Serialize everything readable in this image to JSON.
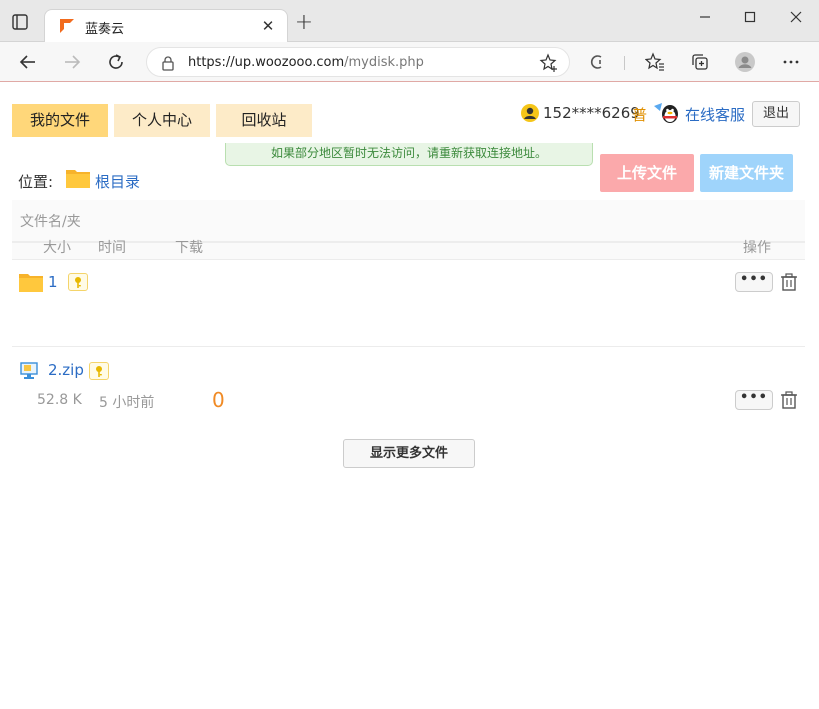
{
  "browser": {
    "tab_title": "蓝奏云",
    "url_host": "https://up.woozooo.com",
    "url_path": "/mydisk.php"
  },
  "nav": {
    "my_files": "我的文件",
    "personal_center": "个人中心",
    "recycle_bin": "回收站"
  },
  "user": {
    "phone": "152****6269",
    "level": "普",
    "online_service": "在线客服",
    "logout": "退出"
  },
  "notice": "如果部分地区暂时无法访问，请重新获取连接地址。",
  "location": {
    "label": "位置:",
    "root": "根目录"
  },
  "actions": {
    "upload": "上传文件",
    "new_folder": "新建文件夹",
    "show_more": "显示更多文件"
  },
  "table": {
    "col_name": "文件名/夹",
    "col_size": "大小",
    "col_time": "时间",
    "col_download": "下载",
    "col_action": "操作"
  },
  "folders": [
    {
      "name": "1"
    }
  ],
  "files": [
    {
      "name": "2.zip",
      "size": "52.8 K",
      "time": "5 小时前",
      "downloads": "0"
    }
  ],
  "colors": {
    "accent_link": "#2b6cc4",
    "upload_btn": "#fba9ab",
    "new_folder_btn": "#9fd4fb",
    "active_tab": "#ffd77a",
    "download_count": "#f08a24"
  }
}
